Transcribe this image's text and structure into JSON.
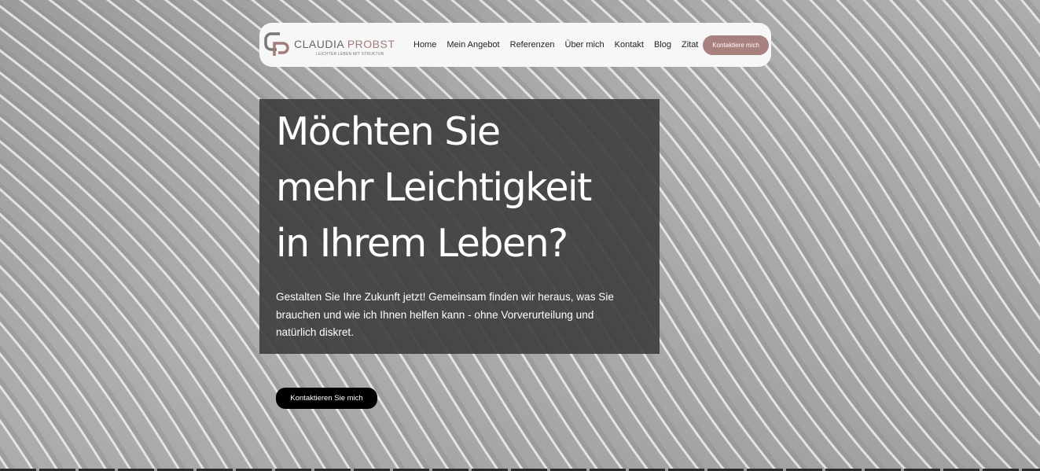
{
  "theme": {
    "accent": "#a8807d",
    "background": "#a5a5a5",
    "hero_box": "#403e3e",
    "button": "#000000"
  },
  "header": {
    "logo": {
      "monogram": "CP",
      "name_first": "CLAUDIA",
      "name_last": "PROBST",
      "tagline": "LEICHTER LEBEN MIT STRUKTUR"
    },
    "menu": [
      {
        "label": "Home",
        "key": "home"
      },
      {
        "label": "Mein Angebot",
        "key": "mein-angebot"
      },
      {
        "label": "Referenzen",
        "key": "referenzen"
      },
      {
        "label": "Über mich",
        "key": "ueber-mich"
      },
      {
        "label": "Kontakt",
        "key": "kontakt"
      },
      {
        "label": "Blog",
        "key": "blog"
      },
      {
        "label": "Zitat",
        "key": "zitat"
      }
    ],
    "cta_label": "Kontaktiere mich"
  },
  "hero": {
    "title_lines": [
      "Möchten Sie",
      "mehr Leichtigkeit",
      "in Ihrem Leben?"
    ],
    "text_lines": [
      "Gestalten Sie Ihre Zukunft jetzt! Gemeinsam finden wir heraus, was Sie",
      "brauchen und wie ich Ihnen helfen kann - ohne Vorverurteilung und",
      "natürlich diskret."
    ],
    "button_label": "Kontaktieren Sie mich"
  }
}
